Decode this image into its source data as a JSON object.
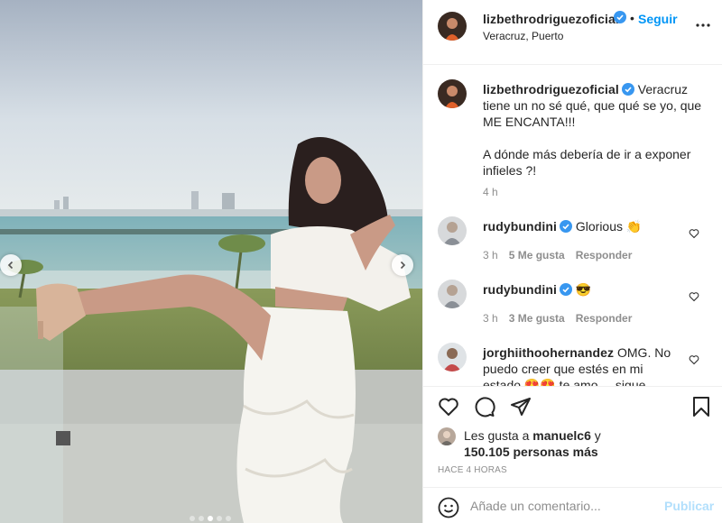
{
  "post": {
    "username": "lizbethrodriguezoficial",
    "follow_label": "Seguir",
    "dot": "•",
    "location": "Veracruz, Puerto"
  },
  "caption": {
    "username": "lizbethrodriguezoficial",
    "lines": [
      "Veracruz",
      "tiene un no sé qué, que qué se yo, que",
      "ME ENCANTA!!!",
      "",
      "A dónde más debería de ir a exponer",
      "infieles ?!"
    ],
    "time": "4 h"
  },
  "comments": [
    {
      "username": "rudybundini",
      "text": "Glorious 👏",
      "time": "3 h",
      "likes": "5 Me gusta",
      "reply": "Responder"
    },
    {
      "username": "rudybundini",
      "text": "😎",
      "time": "3 h",
      "likes": "3 Me gusta",
      "reply": "Responder"
    },
    {
      "username": "jorghiithoohernandez",
      "text_line1": "OMG. No",
      "text_line2": "puedo creer que estés en mi",
      "text_line3": "estado 😍😍 te amo ... sigue"
    }
  ],
  "likes": {
    "prefix": "Les gusta a",
    "user": "manuelc6",
    "suffix": "y",
    "count": "150.105 personas más"
  },
  "time_ago": "HACE 4 HORAS",
  "add_comment": {
    "placeholder": "Añade un comentario...",
    "publish_label": "Publicar"
  },
  "carousel": {
    "total": 5,
    "active": 3
  },
  "colors": {
    "link": "#0095f6",
    "verified": "#3897f0",
    "muted": "#8e8e8e",
    "publish_disabled": "#b2dffc"
  },
  "icons": [
    "chevron-left-icon",
    "chevron-right-icon",
    "more-icon",
    "verified-icon",
    "heart-icon",
    "comment-icon",
    "share-icon",
    "bookmark-icon",
    "emoji-icon"
  ]
}
